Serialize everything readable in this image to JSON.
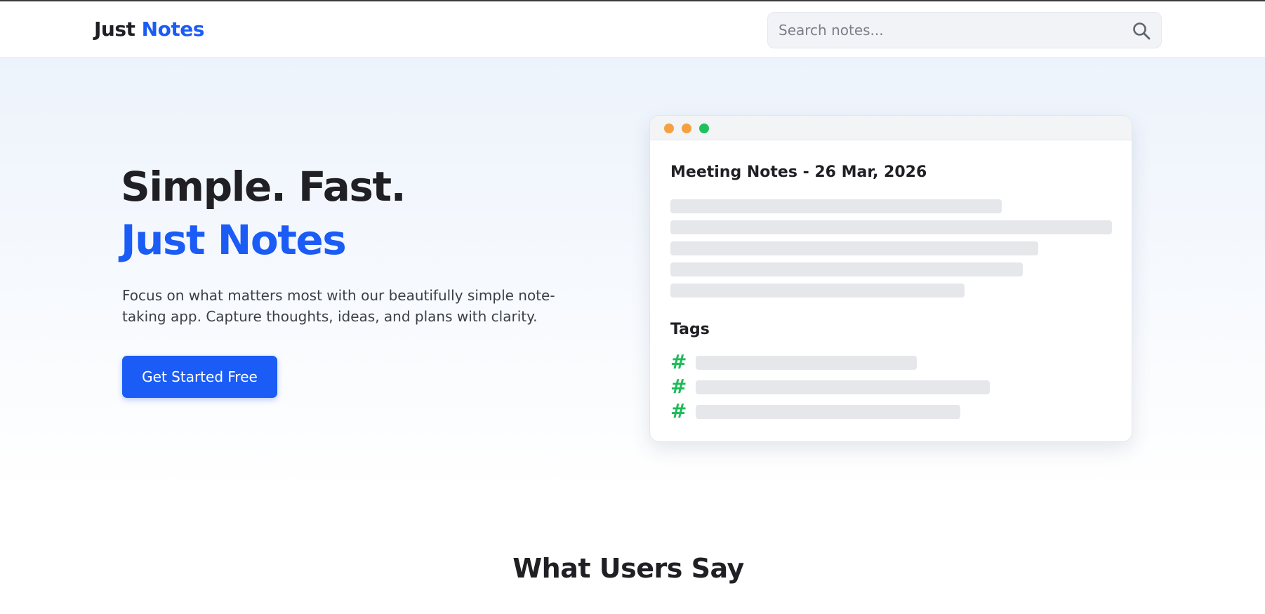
{
  "brand": {
    "name_part1": "Just",
    "name_part2": "Notes",
    "accent_color": "#1a5cf5"
  },
  "search": {
    "placeholder": "Search notes...",
    "icon": "search-icon"
  },
  "hero": {
    "headline_line1": "Simple. Fast.",
    "headline_line2": "Just Notes",
    "subtitle": "Focus on what matters most with our beautifully simple note-taking app. Capture thoughts, ideas, and plans with clarity.",
    "cta_label": "Get Started Free"
  },
  "note_card": {
    "window_dots": [
      "#f5a142",
      "#f5a142",
      "#1fc15e"
    ],
    "title": "Meeting Notes - 26 Mar, 2026",
    "tags_heading": "Tags",
    "tag_symbol": "#",
    "tag_color": "#1fba5a"
  },
  "testimonials": {
    "heading": "What Users Say"
  }
}
